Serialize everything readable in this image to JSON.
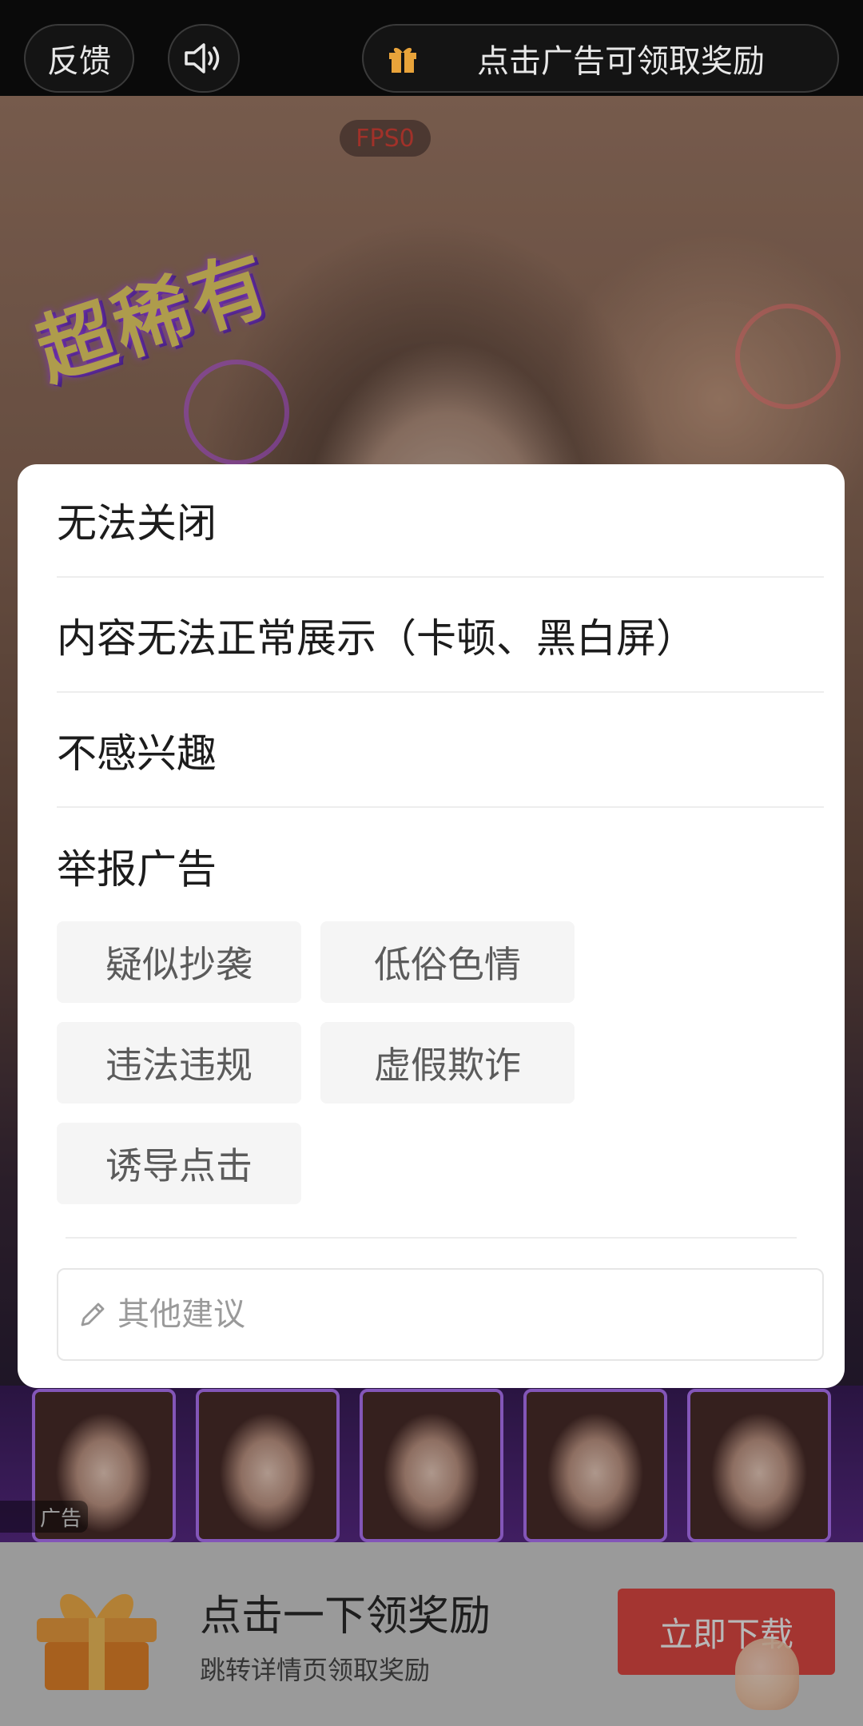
{
  "topbar": {
    "feedback_label": "反馈",
    "reward_label": "点击广告可领取奖励"
  },
  "ad": {
    "fps_label": "FPS0",
    "logo_text": "超稀有",
    "ad_tag": "广告",
    "banner_title": "点击一下领奖励",
    "banner_subtitle": "跳转详情页领取奖励",
    "download_label": "立即下载"
  },
  "dialog": {
    "options": [
      {
        "label": "无法关闭"
      },
      {
        "label": "内容无法正常展示（卡顿、黑白屏）"
      },
      {
        "label": "不感兴趣"
      }
    ],
    "report_title": "举报广告",
    "report_reasons": [
      "疑似抄袭",
      "低俗色情",
      "违法违规",
      "虚假欺诈",
      "诱导点击"
    ],
    "suggestion_placeholder": "其他建议"
  },
  "colors": {
    "accent_red": "#e34a44",
    "fps_red": "#e0443a",
    "gift_orange": "#e8942b"
  },
  "icons": [
    "volume-icon",
    "gift-icon",
    "pencil-icon",
    "gift-box-icon",
    "pointing-hand-icon"
  ]
}
